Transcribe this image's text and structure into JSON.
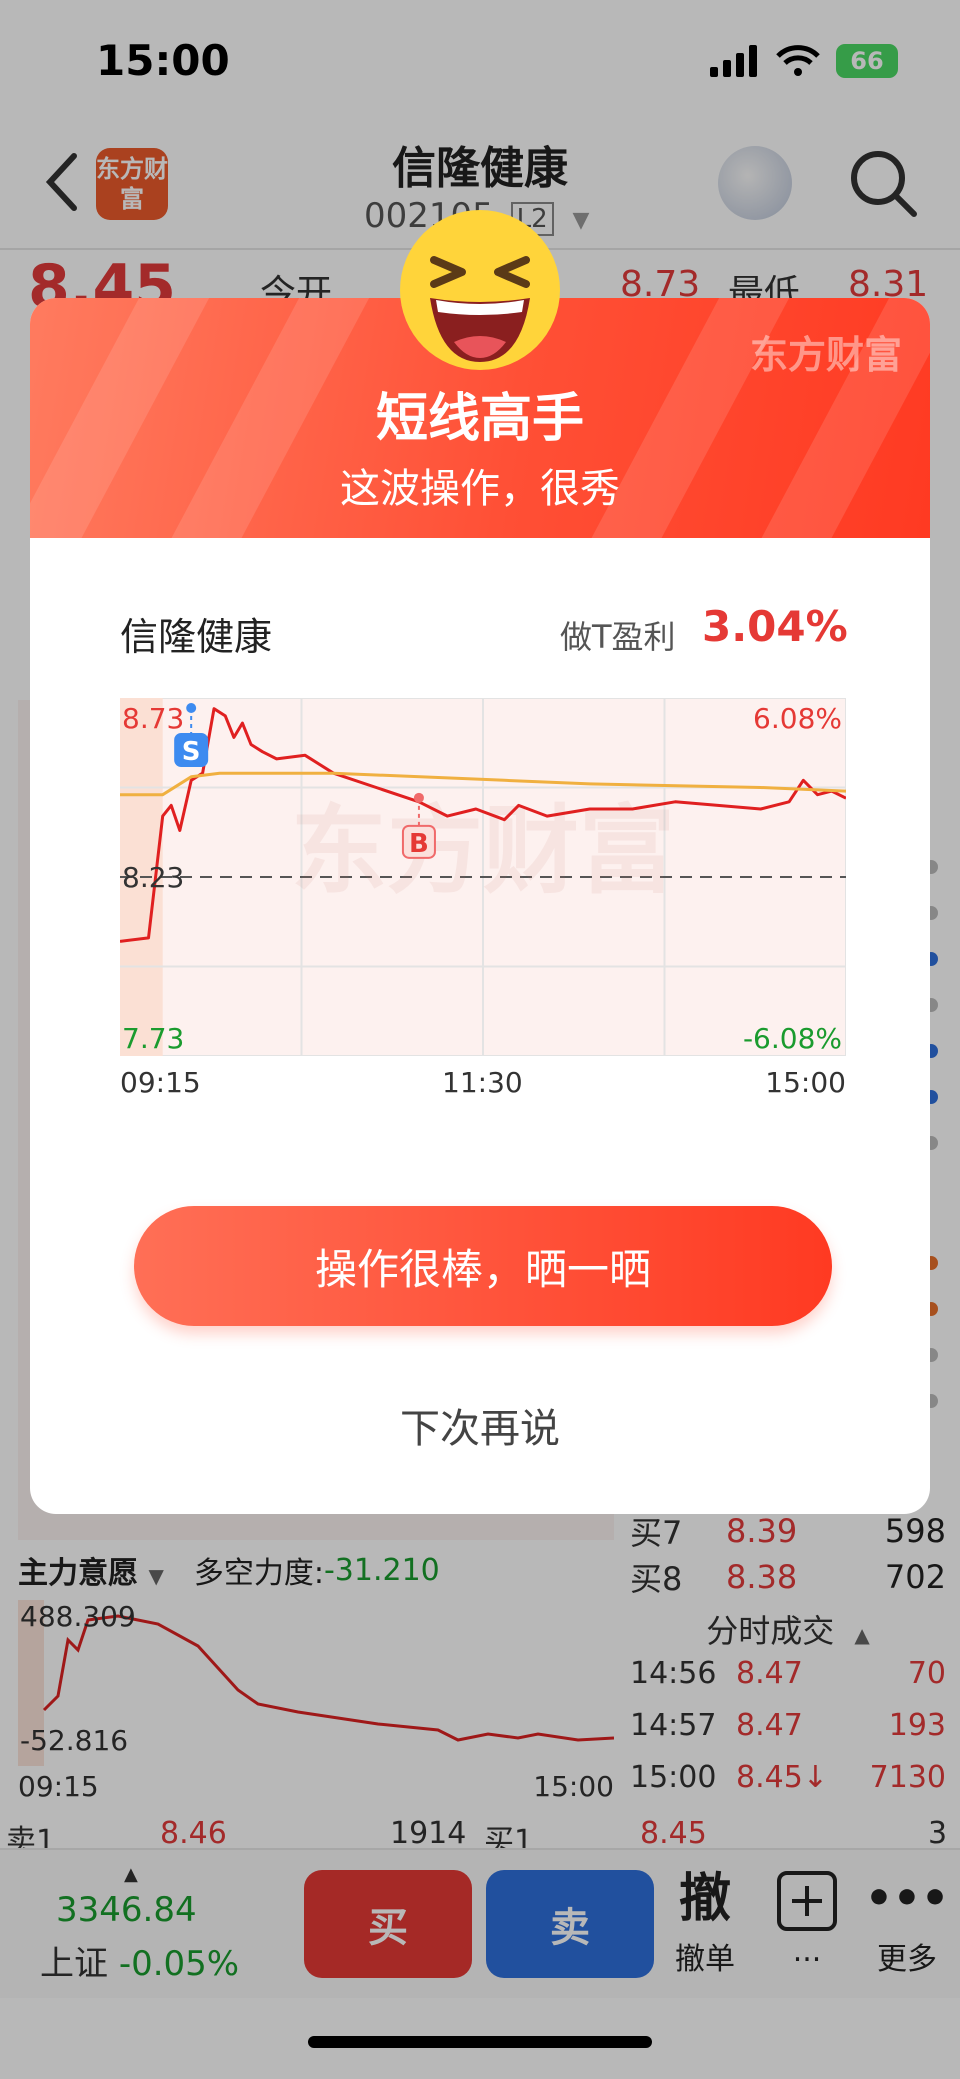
{
  "status_bar": {
    "time": "15:00",
    "battery": "66"
  },
  "nav": {
    "stock_name": "信隆健康",
    "stock_code": "002105",
    "level_badge": "L2",
    "logo_text": "东方财富"
  },
  "background": {
    "price": "8.45",
    "open_label": "今开",
    "high_value": "8.73",
    "low_label": "最低",
    "low_value": "8.31"
  },
  "orders": [
    {
      "label": "买7",
      "price": "8.39",
      "volume": "598"
    },
    {
      "label": "买8",
      "price": "8.38",
      "volume": "702"
    }
  ],
  "sub_indicator": {
    "name": "主力意愿",
    "metric_label": "多空力度:",
    "metric_value": "-31.210",
    "max": "488.309",
    "min": "-52.816",
    "time_start": "09:15",
    "time_end": "15:00"
  },
  "trades": {
    "title": "分时成交",
    "rows": [
      {
        "time": "14:56",
        "price": "8.47",
        "volume": "70"
      },
      {
        "time": "14:57",
        "price": "8.47",
        "volume": "193"
      },
      {
        "time": "15:00",
        "price": "8.45↓",
        "volume": "7130"
      }
    ]
  },
  "order_line": {
    "sell1_label": "卖1",
    "sell1_price": "8.46",
    "sell1_volume": "1914",
    "buy1_label": "买1",
    "buy1_price": "8.45",
    "buy1_volume": "3"
  },
  "bottom_bar": {
    "index_value": "3346.84",
    "index_name": "上证",
    "index_change": "-0.05%",
    "buy_label": "买",
    "sell_label": "卖",
    "cancel_icon_char": "撤",
    "cancel_label": "撤单",
    "more_dots_label": "...",
    "more_label": "更多"
  },
  "modal": {
    "logo": "东方财富",
    "title": "短线高手",
    "subtitle": "这波操作，很秀",
    "stock_name": "信隆健康",
    "profit_label": "做T盈利",
    "profit_value": "3.04%",
    "share_button": "操作很棒，晒一晒",
    "later_link": "下次再说"
  },
  "chart_data": {
    "type": "line",
    "title": "",
    "x_ticks": [
      "09:15",
      "11:30",
      "15:00"
    ],
    "y_left_ticks": [
      "8.73",
      "8.23",
      "7.73"
    ],
    "y_right_ticks": [
      "6.08%",
      "-6.08%"
    ],
    "ylim": [
      7.73,
      8.73
    ],
    "prev_close": 8.23,
    "series": [
      {
        "color": "#e02020",
        "x": [
          "09:15",
          "09:25",
          "09:30",
          "09:33",
          "09:36",
          "09:40",
          "09:44",
          "09:48",
          "09:52",
          "09:55",
          "09:58",
          "10:01",
          "10:05",
          "10:10",
          "10:20",
          "10:30",
          "10:45",
          "11:00",
          "11:10",
          "11:20",
          "11:30",
          "13:05",
          "13:15",
          "13:30",
          "13:45",
          "14:00",
          "14:15",
          "14:30",
          "14:40",
          "14:45",
          "14:50",
          "14:55",
          "15:00"
        ],
        "values": [
          8.05,
          8.06,
          8.4,
          8.43,
          8.36,
          8.5,
          8.52,
          8.7,
          8.68,
          8.62,
          8.66,
          8.6,
          8.58,
          8.56,
          8.57,
          8.52,
          8.48,
          8.44,
          8.4,
          8.42,
          8.39,
          8.43,
          8.4,
          8.42,
          8.42,
          8.44,
          8.43,
          8.42,
          8.44,
          8.5,
          8.46,
          8.47,
          8.45
        ]
      },
      {
        "color": "#f0b040",
        "x": [
          "09:15",
          "09:30",
          "09:40",
          "09:50",
          "10:30",
          "11:30",
          "13:30",
          "14:30",
          "15:00"
        ],
        "values": [
          8.46,
          8.46,
          8.51,
          8.52,
          8.52,
          8.5,
          8.49,
          8.48,
          8.47
        ]
      }
    ],
    "annotations": [
      {
        "label": "S",
        "x": "09:40",
        "y": 8.48
      },
      {
        "label": "B",
        "x": "11:00",
        "y": 8.44
      }
    ],
    "grid": true
  }
}
